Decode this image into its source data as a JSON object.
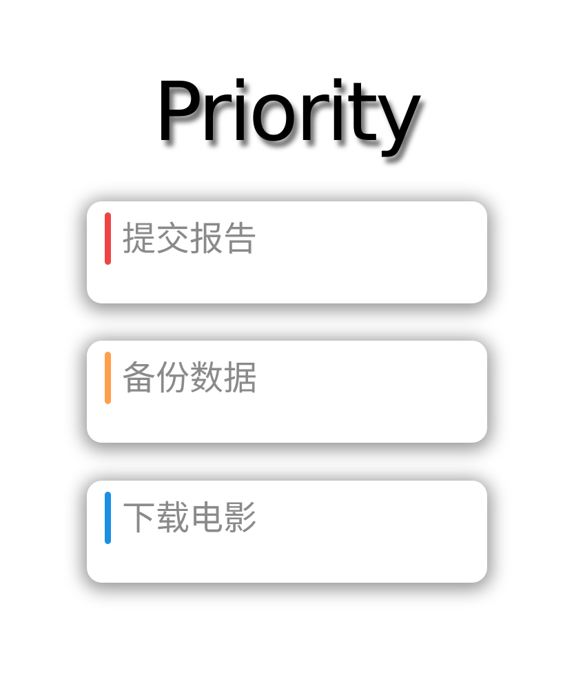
{
  "title": "Priority",
  "tasks": [
    {
      "text": "提交报告",
      "color": "#ef4444"
    },
    {
      "text": "备份数据",
      "color": "#ff9f4a"
    },
    {
      "text": "下载电影",
      "color": "#1a8fe3"
    }
  ]
}
